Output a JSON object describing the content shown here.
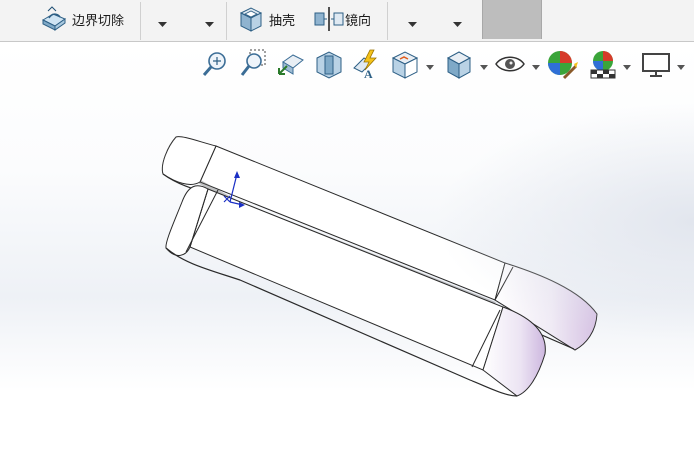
{
  "toolbar": {
    "boundary_cut_label": "边界切除",
    "shell_label": "抽壳",
    "mirror_label": "镜向"
  },
  "hud": {
    "buttons": [
      "zoom-to-fit-icon",
      "zoom-to-area-icon",
      "previous-view-icon",
      "section-view-icon",
      "dynamic-annotation-icon",
      "view-orientation-icon",
      "display-style-icon",
      "hide-show-items-icon",
      "edit-appearance-icon",
      "apply-scene-icon",
      "view-settings-icon"
    ]
  },
  "colors": {
    "toolbar_bg": "#f3f3f3",
    "swatch": "#bdbdbd",
    "model_face": "#ffffff",
    "model_edge": "#2a2a2a",
    "tint": "#d9c6e6",
    "axis_triad": "#1a2fc4"
  }
}
